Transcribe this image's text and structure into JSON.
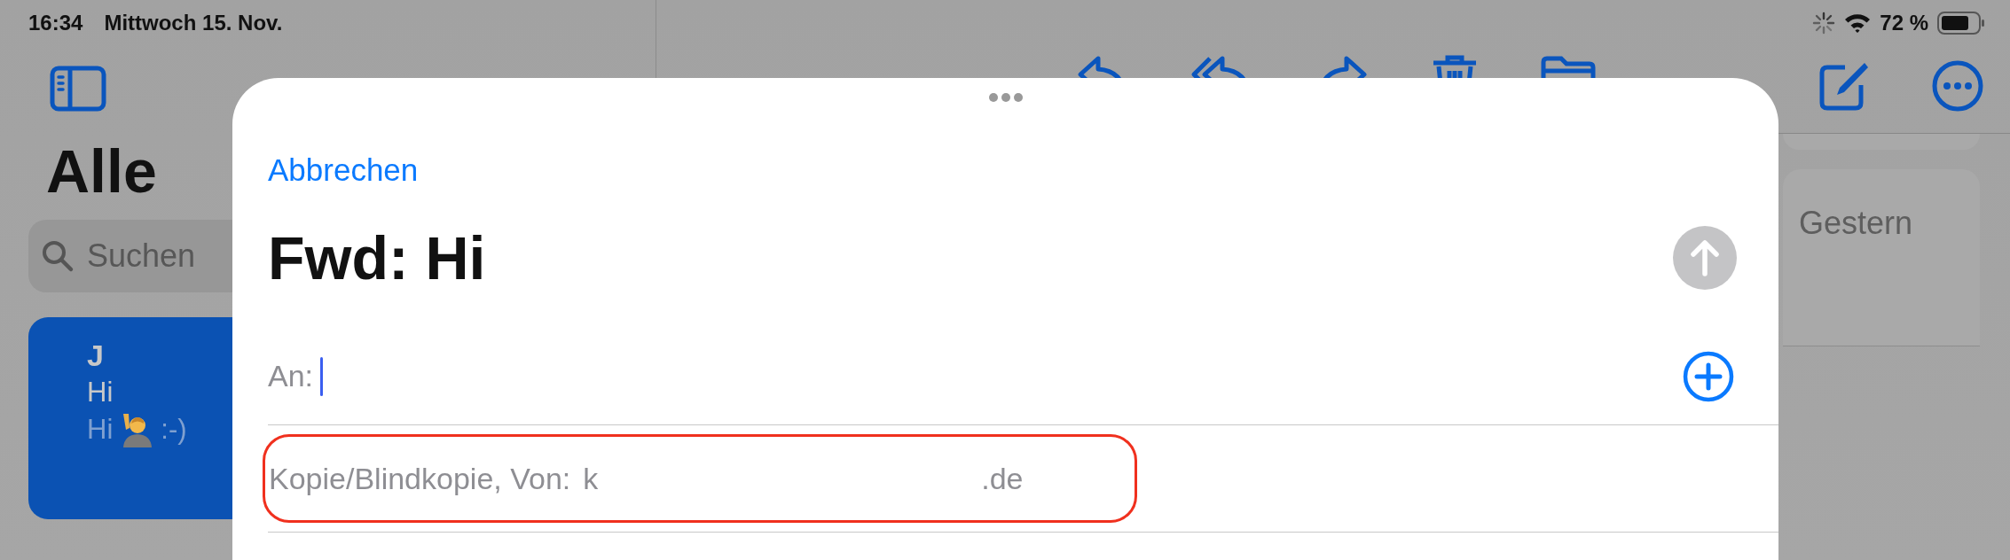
{
  "status_bar": {
    "time": "16:34",
    "date": "Mittwoch 15. Nov.",
    "battery": "72 %"
  },
  "sidebar": {
    "title": "Alle",
    "search": {
      "placeholder": "Suchen"
    },
    "messages": [
      {
        "sender": "J",
        "subject": "Hi",
        "preview_start": "Hi",
        "preview_end": ":-)",
        "selected": true
      }
    ]
  },
  "message_list": {
    "date": "Gestern"
  },
  "compose": {
    "cancel": "Abbrechen",
    "subject": "Fwd: Hi",
    "to_label": "An:",
    "cc_label": "Kopie/Blindkopie, Von:",
    "from_start": "k",
    "from_end": ".de"
  }
}
